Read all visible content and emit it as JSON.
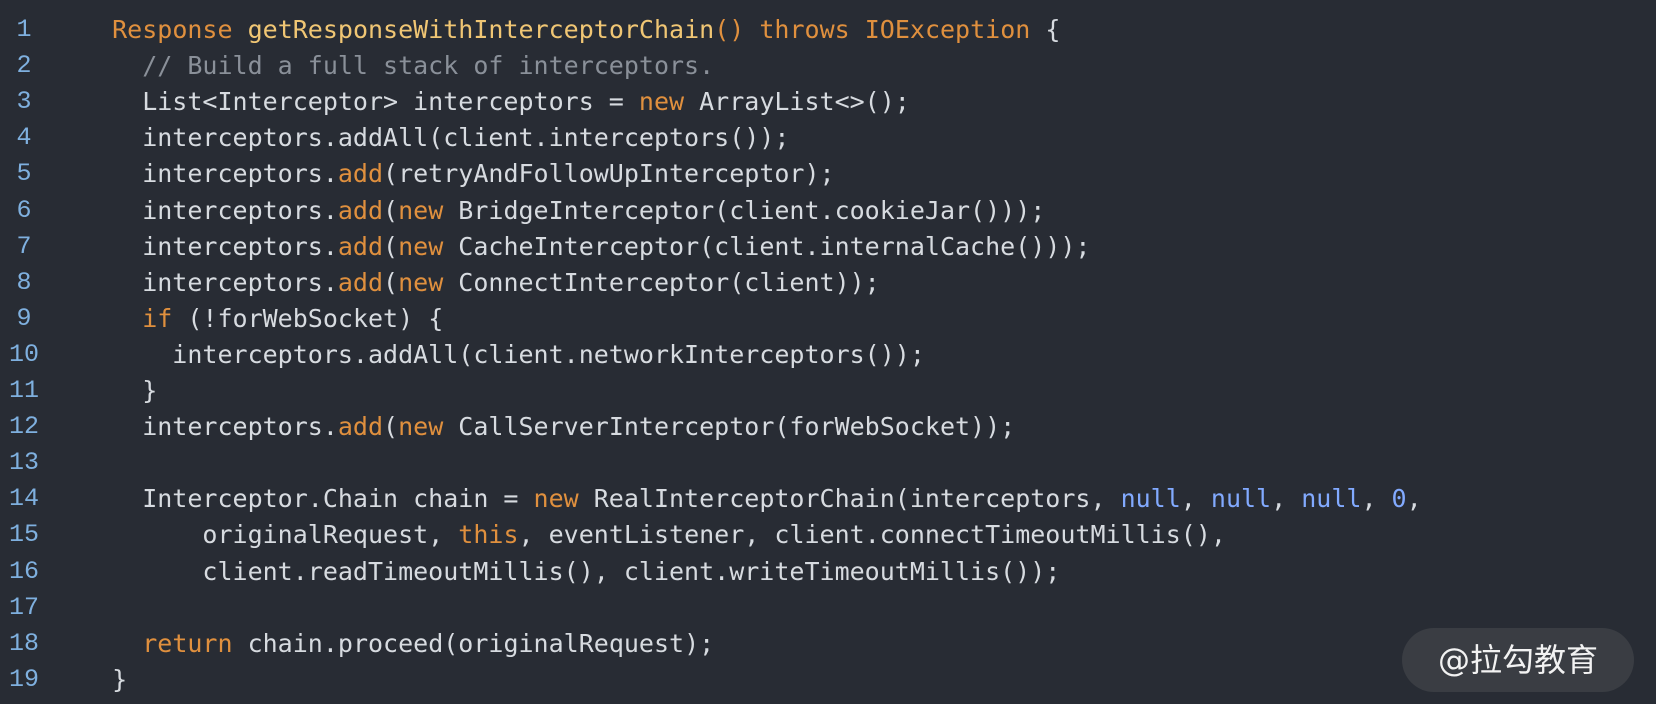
{
  "colors": {
    "background": "#282c34",
    "line_number": "#7fb0df",
    "keyword": "#e0903e",
    "method_name": "#f0c674",
    "comment": "#8a9099",
    "literal": "#82aaff",
    "text": "#d7dbe0"
  },
  "lines": [
    {
      "number": "1",
      "tokens": [
        {
          "t": "tx",
          "v": "  "
        },
        {
          "t": "kw",
          "v": "Response"
        },
        {
          "t": "tx",
          "v": " "
        },
        {
          "t": "fn",
          "v": "getResponseWithInterceptorChain"
        },
        {
          "t": "kw",
          "v": "()"
        },
        {
          "t": "tx",
          "v": " "
        },
        {
          "t": "kw",
          "v": "throws"
        },
        {
          "t": "tx",
          "v": " "
        },
        {
          "t": "kw",
          "v": "IOException"
        },
        {
          "t": "tx",
          "v": " {"
        }
      ]
    },
    {
      "number": "2",
      "tokens": [
        {
          "t": "cm",
          "v": "    // Build a full stack of interceptors."
        }
      ]
    },
    {
      "number": "3",
      "tokens": [
        {
          "t": "tx",
          "v": "    List<Interceptor> interceptors = "
        },
        {
          "t": "kw",
          "v": "new"
        },
        {
          "t": "tx",
          "v": " ArrayList<>();"
        }
      ]
    },
    {
      "number": "4",
      "tokens": [
        {
          "t": "tx",
          "v": "    interceptors.addAll(client.interceptors());"
        }
      ]
    },
    {
      "number": "5",
      "tokens": [
        {
          "t": "tx",
          "v": "    interceptors."
        },
        {
          "t": "mt",
          "v": "add"
        },
        {
          "t": "tx",
          "v": "(retryAndFollowUpInterceptor);"
        }
      ]
    },
    {
      "number": "6",
      "tokens": [
        {
          "t": "tx",
          "v": "    interceptors."
        },
        {
          "t": "mt",
          "v": "add"
        },
        {
          "t": "tx",
          "v": "("
        },
        {
          "t": "kw",
          "v": "new"
        },
        {
          "t": "tx",
          "v": " BridgeInterceptor(client.cookieJar()));"
        }
      ]
    },
    {
      "number": "7",
      "tokens": [
        {
          "t": "tx",
          "v": "    interceptors."
        },
        {
          "t": "mt",
          "v": "add"
        },
        {
          "t": "tx",
          "v": "("
        },
        {
          "t": "kw",
          "v": "new"
        },
        {
          "t": "tx",
          "v": " CacheInterceptor(client.internalCache()));"
        }
      ]
    },
    {
      "number": "8",
      "tokens": [
        {
          "t": "tx",
          "v": "    interceptors."
        },
        {
          "t": "mt",
          "v": "add"
        },
        {
          "t": "tx",
          "v": "("
        },
        {
          "t": "kw",
          "v": "new"
        },
        {
          "t": "tx",
          "v": " ConnectInterceptor(client));"
        }
      ]
    },
    {
      "number": "9",
      "tokens": [
        {
          "t": "tx",
          "v": "    "
        },
        {
          "t": "kw",
          "v": "if"
        },
        {
          "t": "tx",
          "v": " (!forWebSocket) {"
        }
      ]
    },
    {
      "number": "10",
      "tokens": [
        {
          "t": "tx",
          "v": "      interceptors.addAll(client.networkInterceptors());"
        }
      ]
    },
    {
      "number": "11",
      "tokens": [
        {
          "t": "tx",
          "v": "    }"
        }
      ]
    },
    {
      "number": "12",
      "tokens": [
        {
          "t": "tx",
          "v": "    interceptors."
        },
        {
          "t": "mt",
          "v": "add"
        },
        {
          "t": "tx",
          "v": "("
        },
        {
          "t": "kw",
          "v": "new"
        },
        {
          "t": "tx",
          "v": " CallServerInterceptor(forWebSocket));"
        }
      ]
    },
    {
      "number": "13",
      "tokens": []
    },
    {
      "number": "14",
      "tokens": [
        {
          "t": "tx",
          "v": "    Interceptor.Chain chain = "
        },
        {
          "t": "kw",
          "v": "new"
        },
        {
          "t": "tx",
          "v": " RealInterceptorChain(interceptors, "
        },
        {
          "t": "nl",
          "v": "null"
        },
        {
          "t": "tx",
          "v": ", "
        },
        {
          "t": "nl",
          "v": "null"
        },
        {
          "t": "tx",
          "v": ", "
        },
        {
          "t": "nl",
          "v": "null"
        },
        {
          "t": "tx",
          "v": ", "
        },
        {
          "t": "nm",
          "v": "0"
        },
        {
          "t": "tx",
          "v": ","
        }
      ]
    },
    {
      "number": "15",
      "tokens": [
        {
          "t": "tx",
          "v": "        originalRequest, "
        },
        {
          "t": "kw",
          "v": "this"
        },
        {
          "t": "tx",
          "v": ", eventListener, client.connectTimeoutMillis(),"
        }
      ]
    },
    {
      "number": "16",
      "tokens": [
        {
          "t": "tx",
          "v": "        client.readTimeoutMillis(), client.writeTimeoutMillis());"
        }
      ]
    },
    {
      "number": "17",
      "tokens": []
    },
    {
      "number": "18",
      "tokens": [
        {
          "t": "tx",
          "v": "    "
        },
        {
          "t": "kw",
          "v": "return"
        },
        {
          "t": "tx",
          "v": " chain.proceed(originalRequest);"
        }
      ]
    },
    {
      "number": "19",
      "tokens": [
        {
          "t": "tx",
          "v": "  }"
        }
      ]
    }
  ],
  "watermark": {
    "text": "@拉勾教育"
  }
}
